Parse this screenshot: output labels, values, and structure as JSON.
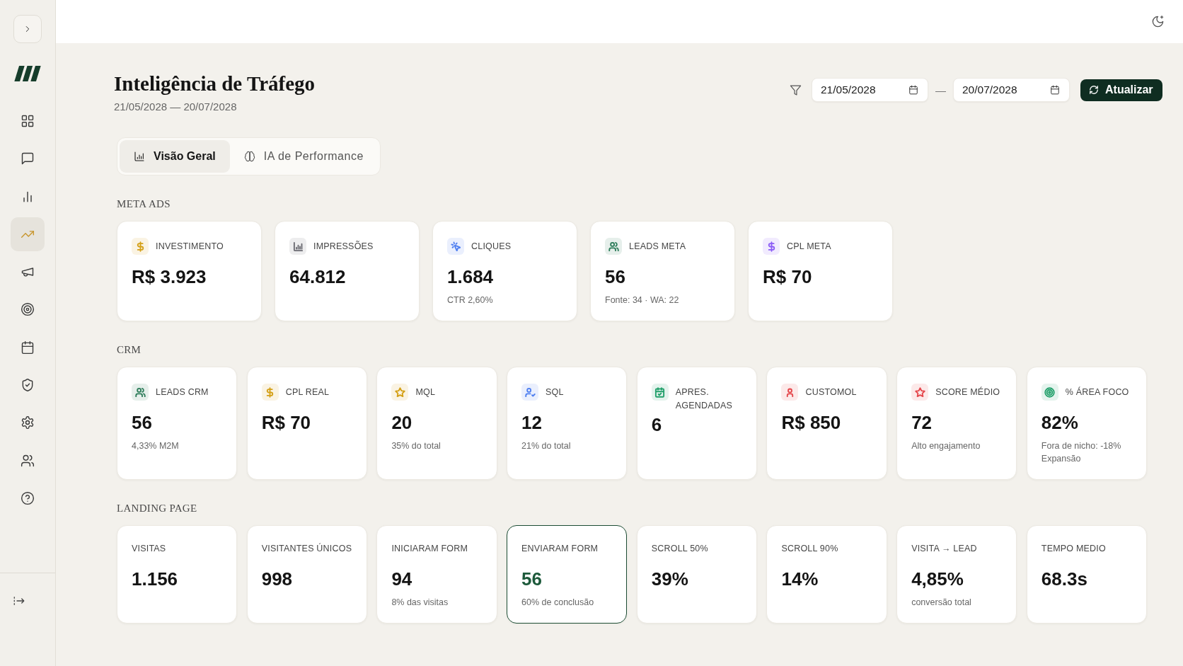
{
  "sidebar": {
    "items": [
      {
        "selected": false
      },
      {
        "selected": false
      },
      {
        "selected": false
      },
      {
        "selected": true
      },
      {
        "selected": false
      },
      {
        "selected": false
      },
      {
        "selected": false
      },
      {
        "selected": false
      },
      {
        "selected": false
      },
      {
        "selected": false
      },
      {
        "selected": false
      }
    ]
  },
  "header": {
    "title": "Inteligência de Tráfego",
    "subtitle": "21/05/2028 — 20/07/2028"
  },
  "date_range": {
    "start": "21/05/2028",
    "separator": "—",
    "end": "20/07/2028",
    "button": "Atualizar"
  },
  "tabs": [
    {
      "label": "Visão Geral",
      "selected": true
    },
    {
      "label": "IA de Performance",
      "selected": false
    }
  ],
  "sections": [
    {
      "title": "META ADS",
      "cards": [
        {
          "label": "INVESTIMENTO",
          "value": "R$ 3.923",
          "color": "#d4a017"
        },
        {
          "label": "IMPRESSÕES",
          "value": "64.812",
          "color": "#6b6b73"
        },
        {
          "label": "CLIQUES",
          "value": "1.684",
          "note": "CTR 2,60%",
          "color": "#4f7ff0"
        },
        {
          "label": "LEADS META",
          "value": "56",
          "note": "Fonte: 34 · WA: 22",
          "color": "#2e7d5b"
        },
        {
          "label": "CPL META",
          "value": "R$ 70",
          "color": "#8b5cf6"
        }
      ]
    },
    {
      "title": "CRM",
      "cards": [
        {
          "label": "LEADS CRM",
          "value": "56",
          "note": "4,33% M2M",
          "color": "#2e7d5b"
        },
        {
          "label": "CPL REAL",
          "value": "R$ 70",
          "color": "#d4a017"
        },
        {
          "label": "MQL",
          "value": "20",
          "note": "35% do total",
          "color": "#d4a017"
        },
        {
          "label": "SQL",
          "value": "12",
          "note": "21% do total",
          "color": "#4f7ff0"
        },
        {
          "label": "APRES. AGENDADAS",
          "value": "6",
          "color": "#22a06b"
        },
        {
          "label": "CUSTOMOL",
          "value": "R$ 850",
          "color": "#e5484d"
        },
        {
          "label": "SCORE MÉDIO",
          "value": "72",
          "note": "Alto engajamento",
          "color": "#e5484d"
        },
        {
          "label": "% ÁREA FOCO",
          "value": "82%",
          "note": "Fora de nicho: -18% Expansão",
          "color": "#22a06b"
        }
      ]
    },
    {
      "title": "LANDING PAGE",
      "cards": [
        {
          "label": "VISITAS",
          "value": "1.156",
          "highlighted": false
        },
        {
          "label": "VISITANTES ÚNICOS",
          "value": "998",
          "highlighted": false
        },
        {
          "label": "INICIARAM FORM",
          "value": "94",
          "note": "8% das visitas",
          "highlighted": false
        },
        {
          "label": "ENVIARAM FORM",
          "value": "56",
          "note": "60% de conclusão",
          "highlighted": true
        },
        {
          "label": "SCROLL 50%",
          "value": "39%",
          "highlighted": false
        },
        {
          "label": "SCROLL 90%",
          "value": "14%",
          "highlighted": false
        },
        {
          "label": "VISITA → LEAD",
          "value": "4,85%",
          "note": "conversão total",
          "highlighted": false
        },
        {
          "label": "TEMPO MEDIO",
          "value": "68.3s",
          "highlighted": false
        }
      ]
    }
  ]
}
